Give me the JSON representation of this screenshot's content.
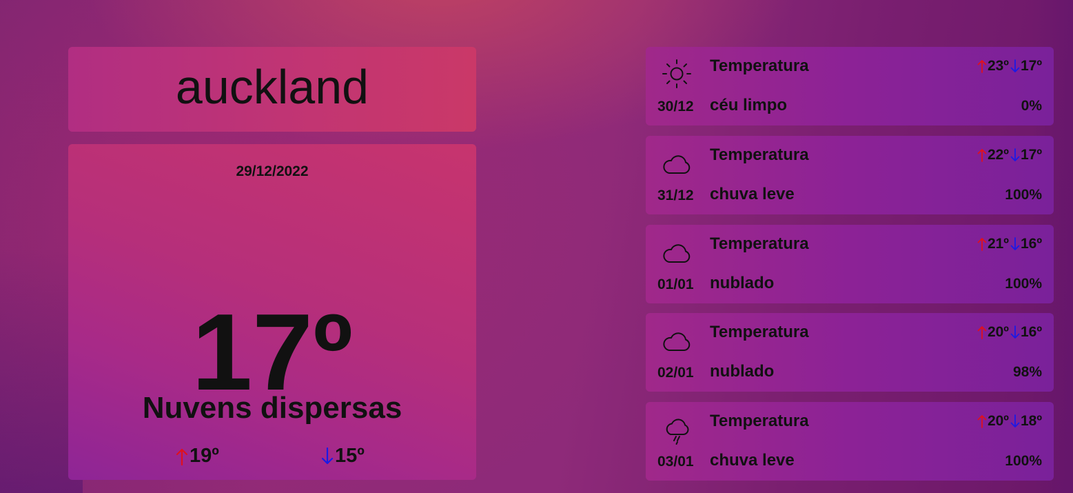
{
  "city": {
    "name": "auckland"
  },
  "today": {
    "date": "29/12/2022",
    "temp": "17º",
    "description": "Nuvens dispersas",
    "max": "19º",
    "min": "15º"
  },
  "colors": {
    "up_arrow": "#e0101e",
    "down_arrow": "#1a1ae6"
  },
  "forecast": [
    {
      "icon": "sun-icon",
      "date": "30/12",
      "label": "Temperatura",
      "description": "céu limpo",
      "max": "23º",
      "min": "17º",
      "precip": "0%"
    },
    {
      "icon": "cloud-icon",
      "date": "31/12",
      "label": "Temperatura",
      "description": "chuva leve",
      "max": "22º",
      "min": "17º",
      "precip": "100%"
    },
    {
      "icon": "cloud-icon",
      "date": "01/01",
      "label": "Temperatura",
      "description": "nublado",
      "max": "21º",
      "min": "16º",
      "precip": "100%"
    },
    {
      "icon": "cloud-icon",
      "date": "02/01",
      "label": "Temperatura",
      "description": "nublado",
      "max": "20º",
      "min": "16º",
      "precip": "98%"
    },
    {
      "icon": "cloud-rain-icon",
      "date": "03/01",
      "label": "Temperatura",
      "description": "chuva leve",
      "max": "20º",
      "min": "18º",
      "precip": "100%"
    }
  ]
}
